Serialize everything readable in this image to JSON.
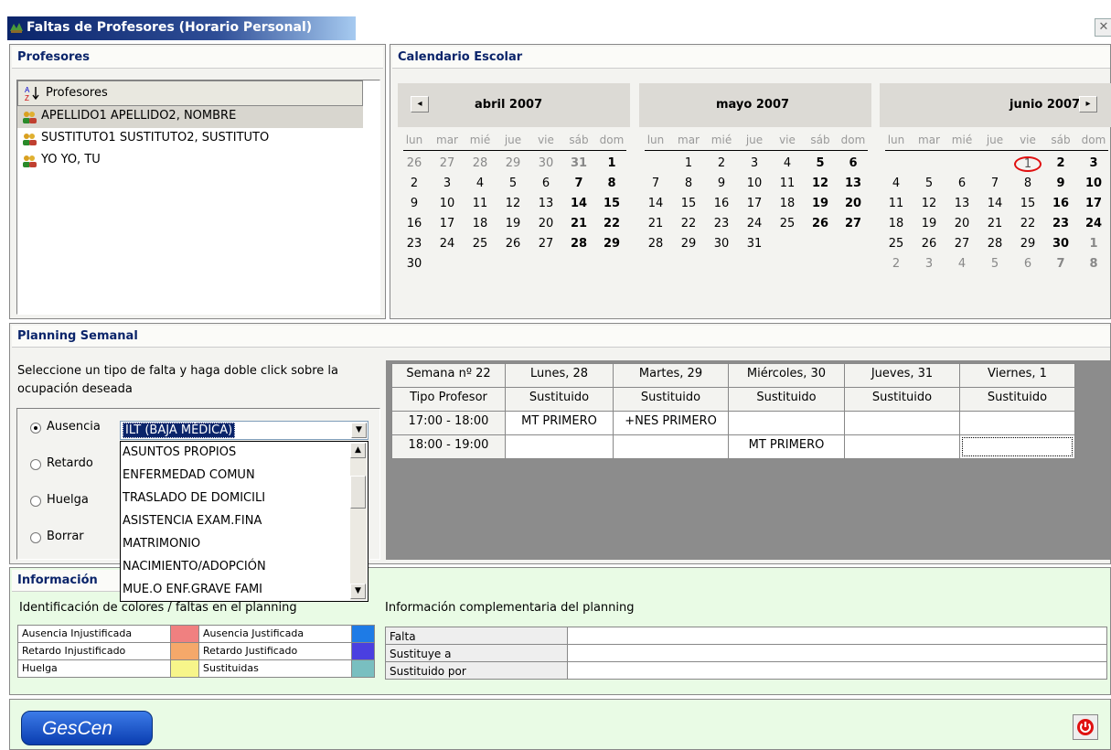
{
  "window": {
    "title": "Faltas de Profesores (Horario Personal)",
    "close_glyph": "✕"
  },
  "teachers_panel": {
    "header": "Profesores",
    "column_label": "Profesores",
    "sort_icon": "sort-az-icon",
    "items": [
      {
        "name": "APELLIDO1 APELLIDO2, NOMBRE",
        "selected": true
      },
      {
        "name": "SUSTITUTO1 SUSTITUTO2, SUSTITUTO",
        "selected": false
      },
      {
        "name": "YO YO, TU",
        "selected": false
      }
    ]
  },
  "calendar_panel": {
    "header": "Calendario Escolar",
    "weekdays": [
      "lun",
      "mar",
      "mié",
      "jue",
      "vie",
      "sáb",
      "dom"
    ],
    "prev_glyph": "◂",
    "next_glyph": "▸",
    "months": [
      {
        "title": "abril 2007",
        "weeks": [
          [
            [
              "26",
              "o"
            ],
            [
              "27",
              "o"
            ],
            [
              "28",
              "o"
            ],
            [
              "29",
              "o"
            ],
            [
              "30",
              "o"
            ],
            [
              "31",
              "ow"
            ],
            [
              "1",
              "w"
            ]
          ],
          [
            [
              "2",
              ""
            ],
            [
              "3",
              ""
            ],
            [
              "4",
              ""
            ],
            [
              "5",
              ""
            ],
            [
              "6",
              ""
            ],
            [
              "7",
              "w"
            ],
            [
              "8",
              "w"
            ]
          ],
          [
            [
              "9",
              ""
            ],
            [
              "10",
              ""
            ],
            [
              "11",
              ""
            ],
            [
              "12",
              ""
            ],
            [
              "13",
              ""
            ],
            [
              "14",
              "w"
            ],
            [
              "15",
              "w"
            ]
          ],
          [
            [
              "16",
              ""
            ],
            [
              "17",
              ""
            ],
            [
              "18",
              ""
            ],
            [
              "19",
              ""
            ],
            [
              "20",
              ""
            ],
            [
              "21",
              "w"
            ],
            [
              "22",
              "w"
            ]
          ],
          [
            [
              "23",
              ""
            ],
            [
              "24",
              ""
            ],
            [
              "25",
              ""
            ],
            [
              "26",
              ""
            ],
            [
              "27",
              ""
            ],
            [
              "28",
              "w"
            ],
            [
              "29",
              "w"
            ]
          ],
          [
            [
              "30",
              ""
            ]
          ]
        ]
      },
      {
        "title": "mayo 2007",
        "weeks": [
          [
            [
              "",
              ""
            ],
            [
              "1",
              ""
            ],
            [
              "2",
              ""
            ],
            [
              "3",
              ""
            ],
            [
              "4",
              ""
            ],
            [
              "5",
              "w"
            ],
            [
              "6",
              "w"
            ]
          ],
          [
            [
              "7",
              ""
            ],
            [
              "8",
              ""
            ],
            [
              "9",
              ""
            ],
            [
              "10",
              ""
            ],
            [
              "11",
              ""
            ],
            [
              "12",
              "w"
            ],
            [
              "13",
              "w"
            ]
          ],
          [
            [
              "14",
              ""
            ],
            [
              "15",
              ""
            ],
            [
              "16",
              ""
            ],
            [
              "17",
              ""
            ],
            [
              "18",
              ""
            ],
            [
              "19",
              "w"
            ],
            [
              "20",
              "w"
            ]
          ],
          [
            [
              "21",
              ""
            ],
            [
              "22",
              ""
            ],
            [
              "23",
              ""
            ],
            [
              "24",
              ""
            ],
            [
              "25",
              ""
            ],
            [
              "26",
              "w"
            ],
            [
              "27",
              "w"
            ]
          ],
          [
            [
              "28",
              ""
            ],
            [
              "29",
              ""
            ],
            [
              "30",
              ""
            ],
            [
              "31",
              ""
            ]
          ]
        ]
      },
      {
        "title": "junio 2007",
        "weeks": [
          [
            [
              "",
              ""
            ],
            [
              "",
              ""
            ],
            [
              "",
              ""
            ],
            [
              "",
              ""
            ],
            [
              "1",
              "t"
            ],
            [
              "2",
              "w"
            ],
            [
              "3",
              "w"
            ]
          ],
          [
            [
              "4",
              ""
            ],
            [
              "5",
              ""
            ],
            [
              "6",
              ""
            ],
            [
              "7",
              ""
            ],
            [
              "8",
              ""
            ],
            [
              "9",
              "w"
            ],
            [
              "10",
              "w"
            ]
          ],
          [
            [
              "11",
              ""
            ],
            [
              "12",
              ""
            ],
            [
              "13",
              ""
            ],
            [
              "14",
              ""
            ],
            [
              "15",
              ""
            ],
            [
              "16",
              "w"
            ],
            [
              "17",
              "w"
            ]
          ],
          [
            [
              "18",
              ""
            ],
            [
              "19",
              ""
            ],
            [
              "20",
              ""
            ],
            [
              "21",
              ""
            ],
            [
              "22",
              ""
            ],
            [
              "23",
              "w"
            ],
            [
              "24",
              "w"
            ]
          ],
          [
            [
              "25",
              ""
            ],
            [
              "26",
              ""
            ],
            [
              "27",
              ""
            ],
            [
              "28",
              ""
            ],
            [
              "29",
              ""
            ],
            [
              "30",
              "w"
            ],
            [
              "1",
              "ow"
            ]
          ],
          [
            [
              "2",
              "o"
            ],
            [
              "3",
              "o"
            ],
            [
              "4",
              "o"
            ],
            [
              "5",
              "o"
            ],
            [
              "6",
              "o"
            ],
            [
              "7",
              "ow"
            ],
            [
              "8",
              "ow"
            ]
          ]
        ]
      }
    ]
  },
  "planning_panel": {
    "header": "Planning Semanal",
    "instructions": "Seleccione un tipo de falta y haga doble click sobre la ocupación deseada",
    "radios": [
      {
        "label": "Ausencia",
        "checked": true
      },
      {
        "label": "Retardo",
        "checked": false
      },
      {
        "label": "Huelga",
        "checked": false
      },
      {
        "label": "Borrar",
        "checked": false
      }
    ],
    "combo_value": "ILT (BAJA MÉDICA)",
    "dropdown_options": [
      "ASUNTOS PROPIOS",
      "ENFERMEDAD COMUN",
      "TRASLADO DE DOMICILI",
      "ASISTENCIA EXAM.FINA",
      "MATRIMONIO",
      "NACIMIENTO/ADOPCIÓN",
      "MUE.O ENF.GRAVE FAMI"
    ],
    "grid": {
      "week_label": "Semana nº 22",
      "days": [
        "Lunes, 28",
        "Martes, 29",
        "Miércoles, 30",
        "Jueves, 31",
        "Viernes, 1"
      ],
      "type_label": "Tipo Profesor",
      "types": [
        "Sustituido",
        "Sustituido",
        "Sustituido",
        "Sustituido",
        "Sustituido"
      ],
      "rows": [
        {
          "time": "17:00 - 18:00",
          "cells": [
            "MT PRIMERO",
            "+NES PRIMERO",
            "",
            "",
            ""
          ]
        },
        {
          "time": "18:00 - 19:00",
          "cells": [
            "",
            "",
            "MT PRIMERO",
            "",
            ""
          ]
        }
      ]
    }
  },
  "info_panel": {
    "header": "Información",
    "legend_title": "Identificación de colores / faltas en el planning",
    "legend": [
      {
        "left": "Ausencia Injustificada",
        "left_color": "#f08080",
        "right": "Ausencia Justificada",
        "right_color": "#1e7be6"
      },
      {
        "left": "Retardo Injustificado",
        "left_color": "#f5a86a",
        "right": "Retardo Justificado",
        "right_color": "#4a3fe0"
      },
      {
        "left": "Huelga",
        "left_color": "#f7f58a",
        "right": "Sustituidas",
        "right_color": "#79bfc0"
      }
    ],
    "complementary_title": "Información complementaria del planning",
    "complementary_rows": [
      {
        "label": "Falta",
        "value": ""
      },
      {
        "label": "Sustituye a",
        "value": ""
      },
      {
        "label": "Sustituido por",
        "value": ""
      }
    ]
  },
  "footer": {
    "logo_text": "GesCen",
    "power_icon": "power-icon"
  }
}
